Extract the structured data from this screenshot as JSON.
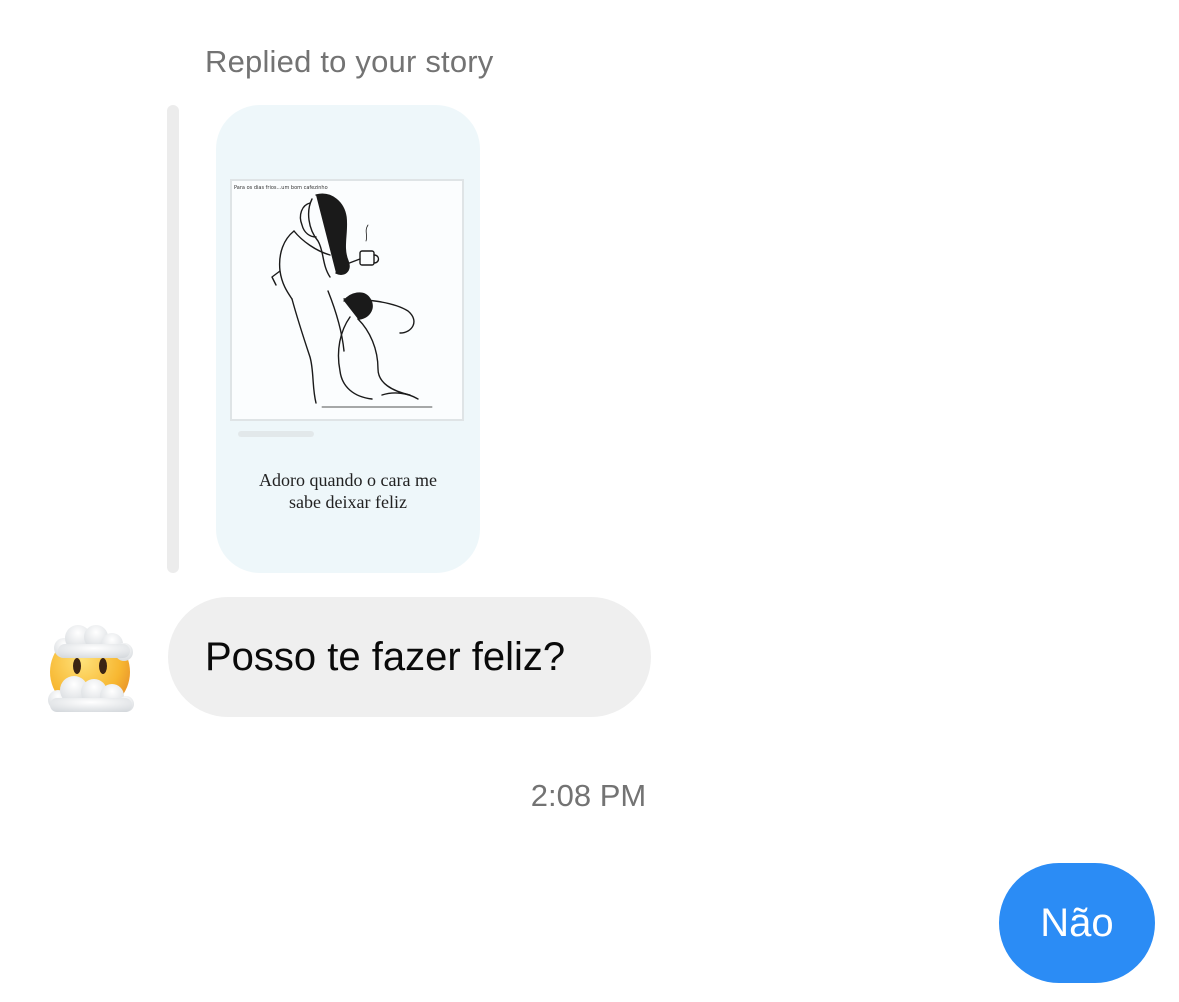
{
  "reply_context": {
    "label": "Replied to your story"
  },
  "story": {
    "frame_title": "Para os dias frios...um bom cafezinho",
    "caption_line1": "Adoro quando o cara me",
    "caption_line2": "sabe deixar feliz"
  },
  "sender": {
    "avatar_icon": "face-in-clouds-emoji-icon"
  },
  "messages": [
    {
      "direction": "incoming",
      "text": "Posso te fazer feliz?"
    },
    {
      "direction": "outgoing",
      "text": "Não"
    }
  ],
  "timestamp": "2:08 PM",
  "colors": {
    "outgoing_bubble": "#2b8cf5",
    "incoming_bubble": "#efefef",
    "meta_text": "#737373"
  }
}
